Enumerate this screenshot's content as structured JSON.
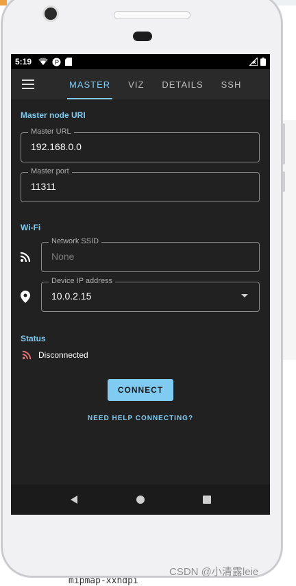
{
  "status_bar": {
    "time": "5:19"
  },
  "tabs": [
    {
      "label": "MASTER",
      "active": true
    },
    {
      "label": "VIZ",
      "active": false
    },
    {
      "label": "DETAILS",
      "active": false
    },
    {
      "label": "SSH",
      "active": false
    }
  ],
  "master_section": {
    "title": "Master node URI",
    "url_label": "Master URL",
    "url_value": "192.168.0.0",
    "port_label": "Master port",
    "port_value": "11311"
  },
  "wifi_section": {
    "title": "Wi-Fi",
    "ssid_label": "Network SSID",
    "ssid_placeholder": "None",
    "ip_label": "Device IP address",
    "ip_value": "10.0.2.15"
  },
  "status_section": {
    "title": "Status",
    "value": "Disconnected",
    "value_color": "#e57373"
  },
  "actions": {
    "connect_label": "CONNECT",
    "help_link": "NEED HELP CONNECTING?"
  },
  "accent_color": "#80cbf1",
  "watermark": "CSDN @小清露leie",
  "background_text": "mipmap-xxhdpi"
}
